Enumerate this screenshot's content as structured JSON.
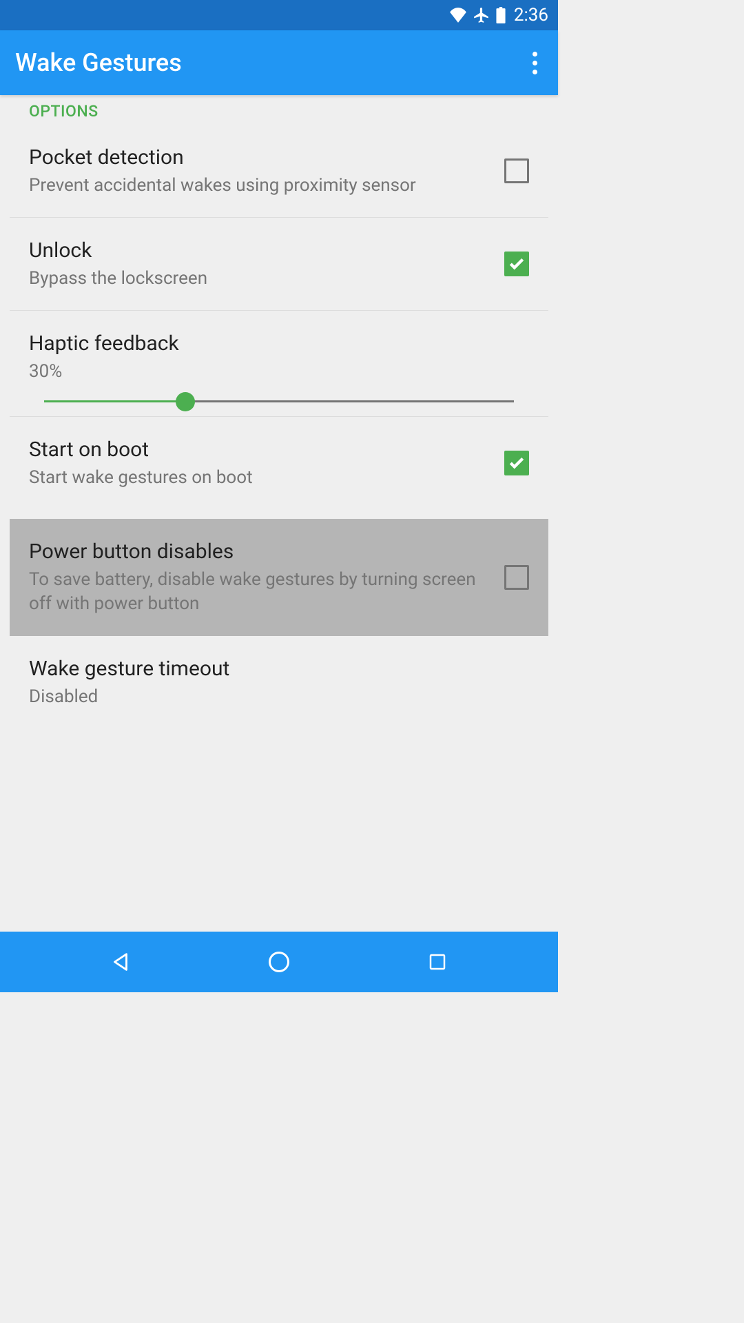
{
  "status": {
    "time": "2:36"
  },
  "appbar": {
    "title": "Wake Gestures"
  },
  "section": {
    "header": "OPTIONS"
  },
  "settings": {
    "pocket": {
      "title": "Pocket detection",
      "subtitle": "Prevent accidental wakes using proximity sensor"
    },
    "unlock": {
      "title": "Unlock",
      "subtitle": "Bypass the lockscreen"
    },
    "haptic": {
      "title": "Haptic feedback",
      "value": "30%"
    },
    "boot": {
      "title": "Start on boot",
      "subtitle": "Start wake gestures on boot"
    },
    "power": {
      "title": "Power button disables",
      "subtitle": "To save battery, disable wake gestures by turning screen off with power button"
    },
    "timeout": {
      "title": "Wake gesture timeout",
      "subtitle": "Disabled"
    }
  }
}
